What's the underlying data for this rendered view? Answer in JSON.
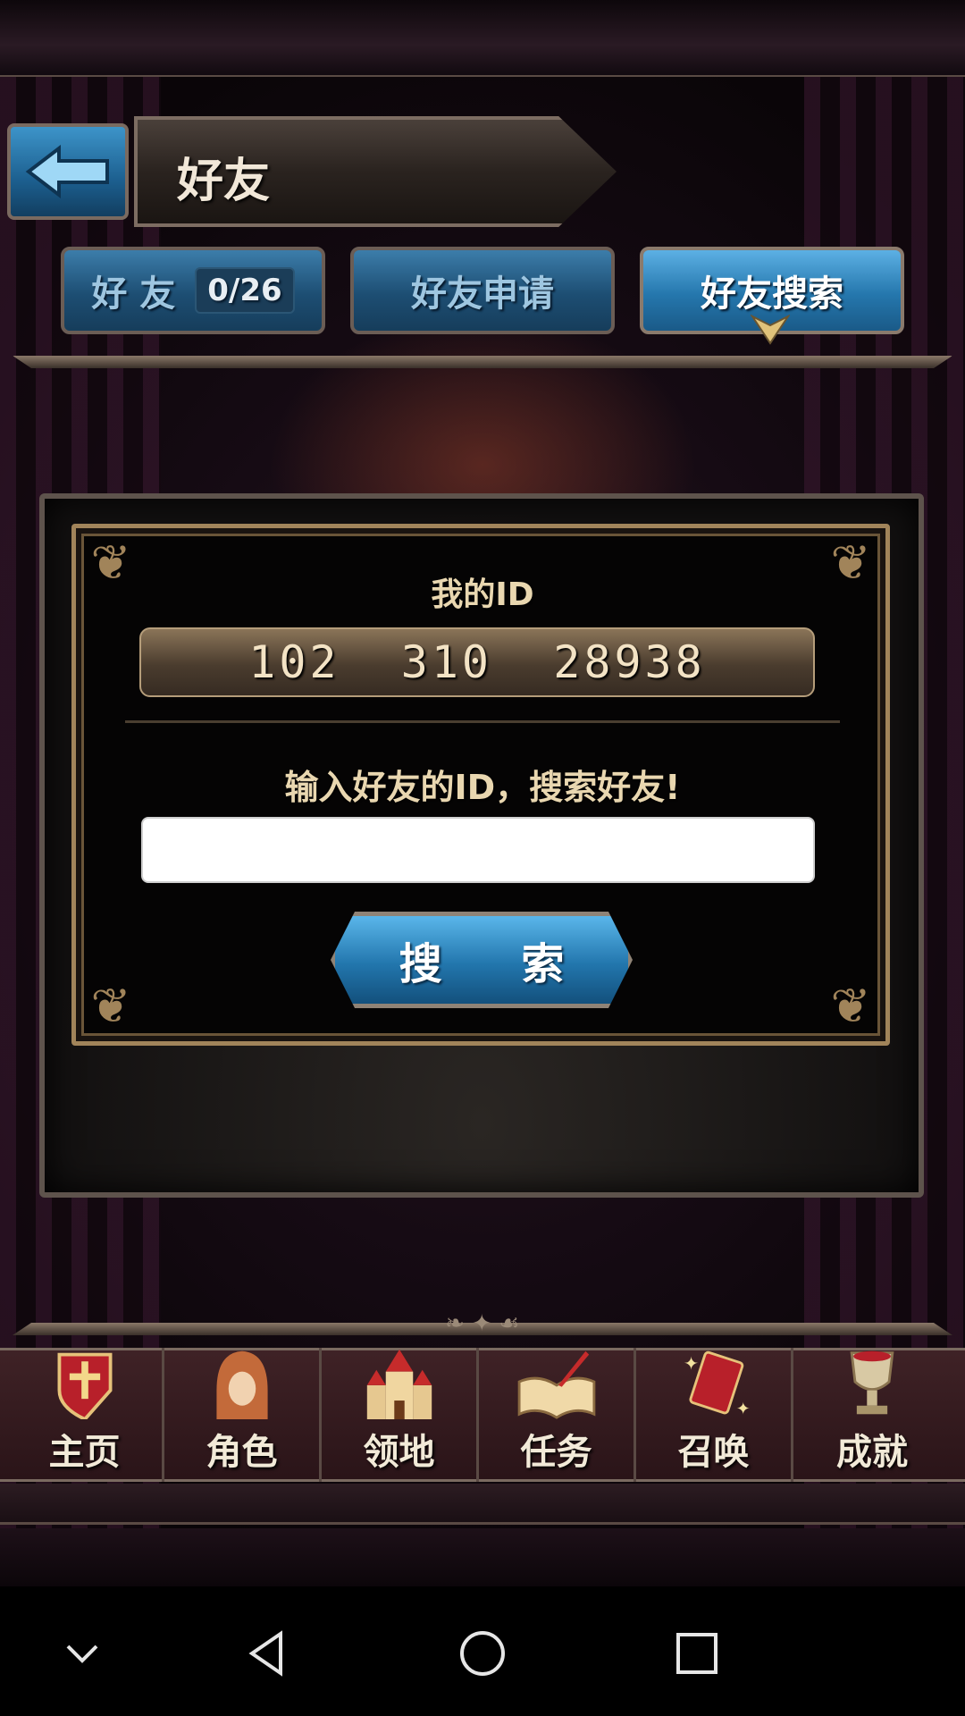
{
  "header": {
    "title": "好友"
  },
  "tabs": [
    {
      "label": "好 友",
      "count": "0/26",
      "active": false
    },
    {
      "label": "好友申请",
      "active": false
    },
    {
      "label": "好友搜索",
      "active": true
    }
  ],
  "panel": {
    "my_id_label": "我的ID",
    "my_id_value": "102  310  28938",
    "search_prompt": "输入好友的ID，搜索好友!",
    "search_input_value": "",
    "search_button": "搜 索"
  },
  "bottom_nav": [
    {
      "label": "主页",
      "icon": "shield-cross-icon"
    },
    {
      "label": "角色",
      "icon": "hooded-character-icon"
    },
    {
      "label": "领地",
      "icon": "castle-icon"
    },
    {
      "label": "任务",
      "icon": "quest-book-icon"
    },
    {
      "label": "召唤",
      "icon": "summon-card-icon"
    },
    {
      "label": "成就",
      "icon": "trophy-icon"
    }
  ],
  "system_nav": [
    "collapse-icon",
    "back-icon",
    "home-icon",
    "recents-icon"
  ],
  "colors": {
    "tab_blue": "#2577ad",
    "gold_text": "#e9d7b0",
    "frame_gold": "#a1845a"
  }
}
